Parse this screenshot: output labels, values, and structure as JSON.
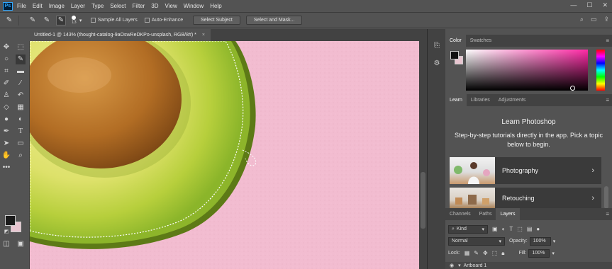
{
  "app": {
    "logo": "Ps",
    "menu": [
      "File",
      "Edit",
      "Image",
      "Layer",
      "Type",
      "Select",
      "Filter",
      "3D",
      "View",
      "Window",
      "Help"
    ]
  },
  "window_controls": {
    "minimize": "—",
    "maximize": "☐",
    "close": "✕"
  },
  "options_bar": {
    "brush_size": "13",
    "sample_all_layers": "Sample All Layers",
    "auto_enhance": "Auto-Enhance",
    "select_subject": "Select Subject",
    "select_and_mask": "Select and Mask..."
  },
  "document": {
    "tab_title": "Untitled-1 @ 143% (thought-catalog-9aOswReDKPo-unsplash, RGB/8#) *",
    "close": "×"
  },
  "panels": {
    "color_tabs": [
      "Color",
      "Swatches"
    ],
    "learn_tabs": [
      "Learn",
      "Libraries",
      "Adjustments"
    ],
    "learn": {
      "title": "Learn Photoshop",
      "description": "Step-by-step tutorials directly in the app. Pick a topic below to begin.",
      "cards": [
        "Photography",
        "Retouching"
      ]
    },
    "layers_tabs": [
      "Channels",
      "Paths",
      "Layers"
    ],
    "layers": {
      "kind": "Kind",
      "blend_mode": "Normal",
      "opacity_label": "Opacity:",
      "opacity_value": "100%",
      "lock_label": "Lock:",
      "fill_label": "Fill:",
      "fill_value": "100%",
      "artboard": "Artboard 1"
    }
  },
  "colors": {
    "ui_bg": "#535353",
    "canvas_pink": "#f2bcd0",
    "foreground": "#111111",
    "background": "#e8c5d0"
  }
}
